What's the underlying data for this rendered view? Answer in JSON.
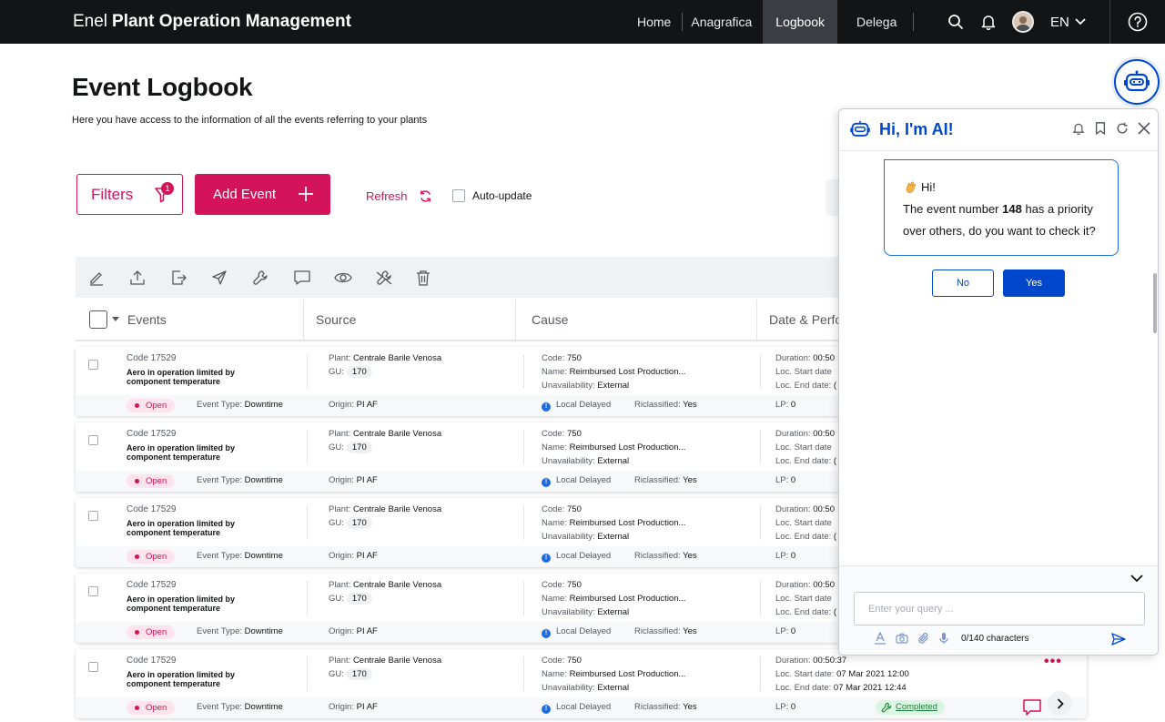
{
  "app": {
    "brand_light": "Enel",
    "brand_bold": "Plant Operation Management"
  },
  "nav": {
    "items": [
      {
        "label": "Home"
      },
      {
        "label": "Anagrafica"
      },
      {
        "label": "Logbook",
        "active": true
      },
      {
        "label": "Delega"
      }
    ],
    "language": "EN"
  },
  "page": {
    "title": "Event Logbook",
    "subtitle": "Here you have access to the information of all the events referring to your plants"
  },
  "actions": {
    "filters_label": "Filters",
    "filters_count": "1",
    "add_event_label": "Add Event",
    "refresh_label": "Refresh",
    "auto_update_label": "Auto-update"
  },
  "toolbar": {
    "icons": [
      "edit-icon",
      "upload-icon",
      "export-icon",
      "send-icon",
      "wrench-icon",
      "comment-icon",
      "view-icon",
      "hide-icon",
      "delete-icon"
    ]
  },
  "table": {
    "columns": [
      "Events",
      "Source",
      "Cause",
      "Date & Perfo"
    ],
    "rows": [
      {
        "code": "Code 17529",
        "title": "Aero in operation limited by component temperature",
        "status": "Open",
        "event_type_key": "Event Type:",
        "event_type": "Downtime",
        "plant_key": "Plant:",
        "plant": "Centrale Barile Venosa",
        "gu_key": "GU:",
        "gu": "170",
        "origin_key": "Origin:",
        "origin": "PI AF",
        "cause_code_key": "Code:",
        "cause_code": "750",
        "cause_name_key": "Name:",
        "cause_name": "Reimbursed Lost Production...",
        "unav_key": "Unavailability:",
        "unav": "External",
        "local": "Local Delayed",
        "riclass_key": "Riclassified:",
        "riclass": "Yes",
        "duration_key": "Duration:",
        "duration": "00:50",
        "start_key": "Loc. Start date",
        "start": "",
        "end_key": "Loc. End date:",
        "end": "(",
        "lp_key": "LP:",
        "lp": "0"
      },
      {
        "code": "Code 17529",
        "title": "Aero in operation limited by component temperature",
        "status": "Open",
        "event_type_key": "Event Type:",
        "event_type": "Downtime",
        "plant_key": "Plant:",
        "plant": "Centrale Barile Venosa",
        "gu_key": "GU:",
        "gu": "170",
        "origin_key": "Origin:",
        "origin": "PI AF",
        "cause_code_key": "Code:",
        "cause_code": "750",
        "cause_name_key": "Name:",
        "cause_name": "Reimbursed Lost Production...",
        "unav_key": "Unavailability:",
        "unav": "External",
        "local": "Local Delayed",
        "riclass_key": "Riclassified:",
        "riclass": "Yes",
        "duration_key": "Duration:",
        "duration": "00:50",
        "start_key": "Loc. Start date",
        "start": "",
        "end_key": "Loc. End date:",
        "end": "(",
        "lp_key": "LP:",
        "lp": "0"
      },
      {
        "code": "Code 17529",
        "title": "Aero in operation limited by component temperature",
        "status": "Open",
        "event_type_key": "Event Type:",
        "event_type": "Downtime",
        "plant_key": "Plant:",
        "plant": "Centrale Barile Venosa",
        "gu_key": "GU:",
        "gu": "170",
        "origin_key": "Origin:",
        "origin": "PI AF",
        "cause_code_key": "Code:",
        "cause_code": "750",
        "cause_name_key": "Name:",
        "cause_name": "Reimbursed Lost Production...",
        "unav_key": "Unavailability:",
        "unav": "External",
        "local": "Local Delayed",
        "riclass_key": "Riclassified:",
        "riclass": "Yes",
        "duration_key": "Duration:",
        "duration": "00:50",
        "start_key": "Loc. Start date",
        "start": "",
        "end_key": "Loc. End date:",
        "end": "(",
        "lp_key": "LP:",
        "lp": "0"
      },
      {
        "code": "Code 17529",
        "title": "Aero in operation limited by component temperature",
        "status": "Open",
        "event_type_key": "Event Type:",
        "event_type": "Downtime",
        "plant_key": "Plant:",
        "plant": "Centrale Barile Venosa",
        "gu_key": "GU:",
        "gu": "170",
        "origin_key": "Origin:",
        "origin": "PI AF",
        "cause_code_key": "Code:",
        "cause_code": "750",
        "cause_name_key": "Name:",
        "cause_name": "Reimbursed Lost Production...",
        "unav_key": "Unavailability:",
        "unav": "External",
        "local": "Local Delayed",
        "riclass_key": "Riclassified:",
        "riclass": "Yes",
        "duration_key": "Duration:",
        "duration": "00:50",
        "start_key": "Loc. Start date",
        "start": "",
        "end_key": "Loc. End date:",
        "end": "(",
        "lp_key": "LP:",
        "lp": "0"
      },
      {
        "code": "Code 17529",
        "title": "Aero in operation limited by component temperature",
        "status": "Open",
        "event_type_key": "Event Type:",
        "event_type": "Downtime",
        "plant_key": "Plant:",
        "plant": "Centrale Barile Venosa",
        "gu_key": "GU:",
        "gu": "170",
        "origin_key": "Origin:",
        "origin": "PI AF",
        "cause_code_key": "Code:",
        "cause_code": "750",
        "cause_name_key": "Name:",
        "cause_name": "Reimbursed Lost Production...",
        "unav_key": "Unavailability:",
        "unav": "External",
        "local": "Local Delayed",
        "riclass_key": "Riclassified:",
        "riclass": "Yes",
        "duration_key": "Duration:",
        "duration": "00:50:37",
        "start_key": "Loc. Start date:",
        "start": "07 Mar 2021 12:00",
        "end_key": "Loc. End date:",
        "end": "07 Mar 2021 12:44",
        "lp_key": "LP:",
        "lp": "0",
        "completed": "Completed"
      }
    ]
  },
  "ai_panel": {
    "title": "Hi, I'm AI!",
    "greeting": "Hi!",
    "message_pre": "The event number",
    "event_number": "148",
    "message_post": "has a priority over others, do you want to check it?",
    "no_label": "No",
    "yes_label": "Yes",
    "input_placeholder": "Enter your query ...",
    "char_count": "0/140 characters"
  },
  "colors": {
    "brand_magenta": "#d3135a",
    "ai_blue": "#0047cc",
    "topbar": "#131416"
  }
}
